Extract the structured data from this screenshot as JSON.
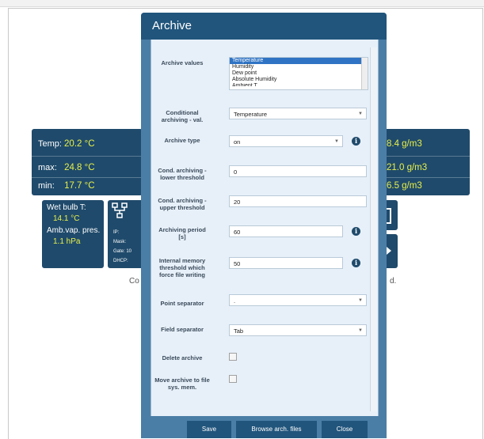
{
  "background": {
    "tile_left": {
      "temp_label": "Temp:",
      "temp_value": "20.2 °C",
      "max_label": "max:",
      "max_value": "24.8 °C",
      "min_label": "min:",
      "min_value": "17.7 °C"
    },
    "tile_right": {
      "value_1": "8.4 g/m3",
      "value_2": "21.0 g/m3",
      "value_3": "6.5 g/m3"
    },
    "wet_bulb": {
      "label": "Wet bulb T:",
      "value": "14.1 °C",
      "vap_label": "Amb.vap. pres.",
      "vap_value": "1.1 hPa"
    },
    "network_tile": {
      "ip": "IP:",
      "mask": "Mask:",
      "gate": "Gate:  10",
      "dhcp": "DHCP:"
    },
    "caption_left": "Co",
    "caption_right": "d."
  },
  "dialog": {
    "title": "Archive",
    "archive_values_label": "Archive values",
    "archive_values_options": [
      "Temperature",
      "Humidity",
      "Dew point",
      "Absolute Humidity",
      "Ambient T"
    ],
    "conditional_label": "Conditional archiving - val.",
    "conditional_value": "Temperature",
    "archive_type_label": "Archive type",
    "archive_type_value": "on",
    "lower_label": "Cond. archiving - lower threshold",
    "lower_value": "0",
    "upper_label": "Cond. archiving - upper threshold",
    "upper_value": "20",
    "period_label": "Archiving period [s]",
    "period_value": "60",
    "memory_label": "Internal memory threshold which force file writing",
    "memory_value": "50",
    "point_sep_label": "Point separator",
    "point_sep_value": ".",
    "field_sep_label": "Field separator",
    "field_sep_value": "Tab",
    "delete_label": "Delete archive",
    "move_label": "Move archive to file sys. mem.",
    "info_glyph": "i",
    "save_button": "Save",
    "browse_button": "Browse arch. files",
    "close_button": "Close"
  }
}
